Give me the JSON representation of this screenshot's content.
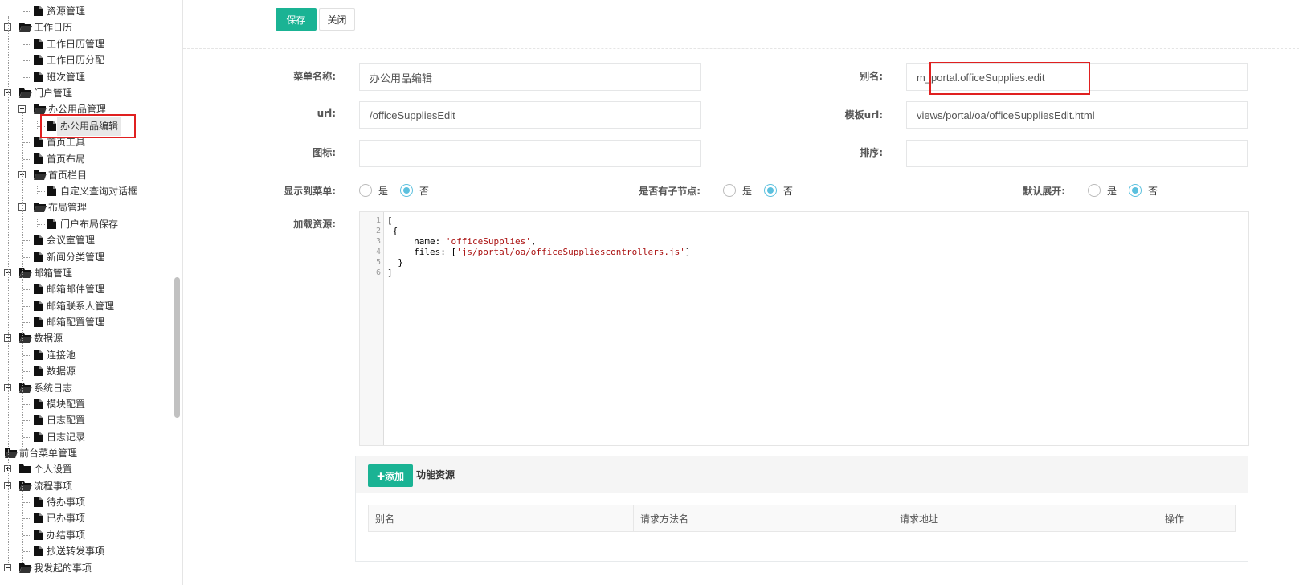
{
  "sidebar": {
    "items": [
      {
        "label": "资源管理",
        "type": "leaf"
      },
      {
        "label": "工作日历",
        "type": "folder-open"
      },
      {
        "label": "工作日历管理",
        "type": "leaf"
      },
      {
        "label": "工作日历分配",
        "type": "leaf"
      },
      {
        "label": "班次管理",
        "type": "leaf"
      },
      {
        "label": "门户管理",
        "type": "folder-open"
      },
      {
        "label": "办公用品管理",
        "type": "folder-open"
      },
      {
        "label": "办公用品编辑",
        "type": "leaf",
        "selected": true
      },
      {
        "label": "首页工具",
        "type": "leaf"
      },
      {
        "label": "首页布局",
        "type": "leaf"
      },
      {
        "label": "首页栏目",
        "type": "folder-open"
      },
      {
        "label": "自定义查询对话框",
        "type": "leaf"
      },
      {
        "label": "布局管理",
        "type": "folder-open"
      },
      {
        "label": "门户布局保存",
        "type": "leaf"
      },
      {
        "label": "会议室管理",
        "type": "leaf"
      },
      {
        "label": "新闻分类管理",
        "type": "leaf"
      },
      {
        "label": "邮箱管理",
        "type": "folder-open"
      },
      {
        "label": "邮箱邮件管理",
        "type": "leaf"
      },
      {
        "label": "邮箱联系人管理",
        "type": "leaf"
      },
      {
        "label": "邮箱配置管理",
        "type": "leaf"
      },
      {
        "label": "数据源",
        "type": "folder-open"
      },
      {
        "label": "连接池",
        "type": "leaf"
      },
      {
        "label": "数据源",
        "type": "leaf"
      },
      {
        "label": "系统日志",
        "type": "folder-open"
      },
      {
        "label": "模块配置",
        "type": "leaf"
      },
      {
        "label": "日志配置",
        "type": "leaf"
      },
      {
        "label": "日志记录",
        "type": "leaf"
      },
      {
        "label": "前台菜单管理",
        "type": "folder-open"
      },
      {
        "label": "个人设置",
        "type": "folder-closed"
      },
      {
        "label": "流程事项",
        "type": "folder-open"
      },
      {
        "label": "待办事项",
        "type": "leaf"
      },
      {
        "label": "已办事项",
        "type": "leaf"
      },
      {
        "label": "办结事项",
        "type": "leaf"
      },
      {
        "label": "抄送转发事项",
        "type": "leaf"
      },
      {
        "label": "我发起的事项",
        "type": "folder-open"
      }
    ]
  },
  "toolbar": {
    "save_label": "保存",
    "close_label": "关闭"
  },
  "form": {
    "menu_name": {
      "label": "菜单名称:",
      "value": "办公用品编辑"
    },
    "alias": {
      "label": "别名:",
      "value": "m_portal.officeSupplies.edit"
    },
    "url": {
      "label": "url:",
      "value": "/officeSuppliesEdit"
    },
    "template_url": {
      "label": "模板url:",
      "value": "views/portal/oa/officeSuppliesEdit.html"
    },
    "icon": {
      "label": "图标:",
      "value": ""
    },
    "sort": {
      "label": "排序:",
      "value": ""
    },
    "show_in_menu": {
      "label": "显示到菜单:",
      "yes": "是",
      "no": "否",
      "selected": "no"
    },
    "has_children": {
      "label": "是否有子节点:",
      "yes": "是",
      "no": "否",
      "selected": "no"
    },
    "default_expand": {
      "label": "默认展开:",
      "yes": "是",
      "no": "否",
      "selected": "no"
    },
    "load_resources": {
      "label": "加载资源:"
    }
  },
  "editor": {
    "line_numbers": [
      "1",
      "2",
      "3",
      "4",
      "5",
      "6"
    ],
    "lines": [
      {
        "plain": "[",
        "str": "",
        "tail": ""
      },
      {
        "plain": " {",
        "str": "",
        "tail": ""
      },
      {
        "plain": "     name: ",
        "str": "'officeSupplies'",
        "tail": ","
      },
      {
        "plain": "     files: [",
        "str": "'js/portal/oa/officeSuppliescontrollers.js'",
        "tail": "]"
      },
      {
        "plain": "  }",
        "str": "",
        "tail": ""
      },
      {
        "plain": "]",
        "str": "",
        "tail": ""
      }
    ]
  },
  "resources": {
    "add_label": "添加",
    "title": "功能资源",
    "columns": [
      "别名",
      "请求方法名",
      "请求地址",
      "操作"
    ]
  },
  "colors": {
    "primary": "#1ab394",
    "radio": "#5bc0de",
    "highlight_box": "#e02020"
  }
}
